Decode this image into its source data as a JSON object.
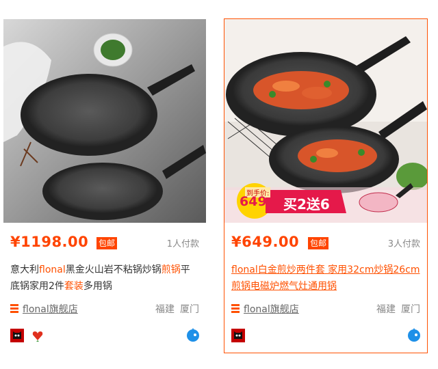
{
  "products": [
    {
      "price": "¥1198.00",
      "badge": "包邮",
      "sold": "1人付款",
      "title": [
        {
          "t": "意大利",
          "hl": false
        },
        {
          "t": "flonal",
          "hl": true
        },
        {
          "t": "黑金火山岩不粘锅炒锅",
          "hl": false
        },
        {
          "t": "煎锅",
          "hl": true
        },
        {
          "t": "平底锅家用2件",
          "hl": false
        },
        {
          "t": "套装",
          "hl": true
        },
        {
          "t": "多用锅",
          "hl": false
        }
      ],
      "shop_name": "flonal旗舰店",
      "province": "福建",
      "city": "厦门",
      "service_icons": [
        "tmall-icon",
        "heart-flower-icon"
      ],
      "colors": {
        "accent": "#ff4400",
        "card_border": "#ffffff"
      }
    },
    {
      "price": "¥649.00",
      "badge": "包邮",
      "sold": "3人付款",
      "title": [
        {
          "t": "flonal",
          "hl": false
        },
        {
          "t": "白金煎炒两件套 家用32cm炒锅26cm煎锅电磁炉燃气灶通用锅",
          "hl": false
        }
      ],
      "shop_name": "flonal旗舰店",
      "province": "福建",
      "city": "厦门",
      "service_icons": [
        "tmall-icon"
      ],
      "promo": {
        "label": "到手价:",
        "price": "649",
        "offer": "买2送6"
      },
      "colors": {
        "accent": "#ff4400",
        "card_border": "#ff5000"
      }
    }
  ]
}
